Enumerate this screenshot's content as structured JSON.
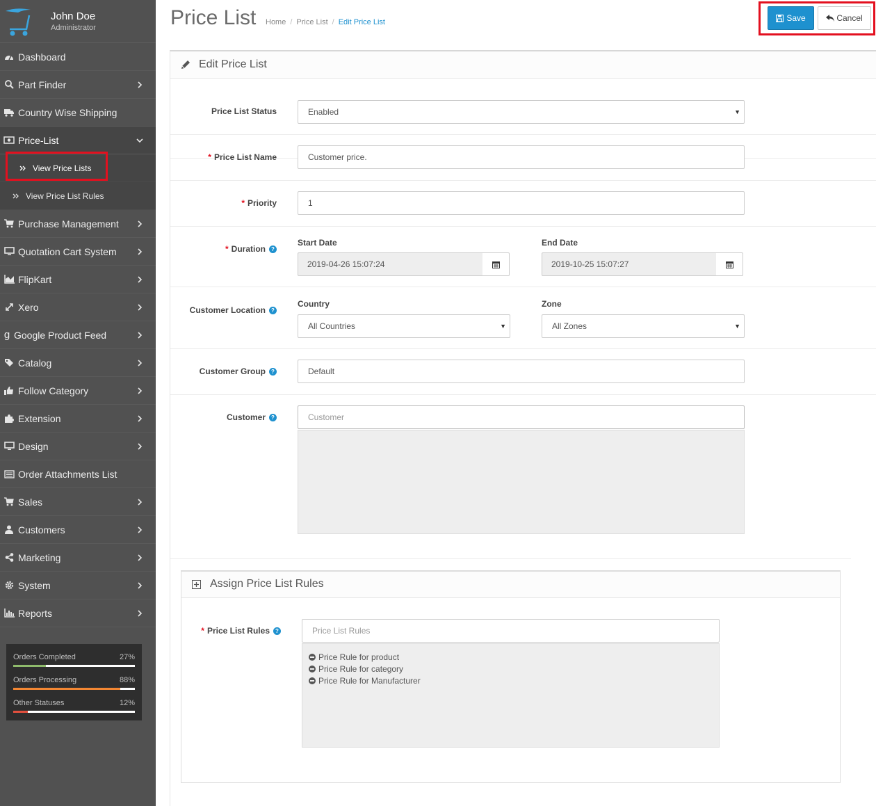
{
  "user": {
    "name": "John Doe",
    "role": "Administrator"
  },
  "sidebar": {
    "items": [
      {
        "label": "Dashboard",
        "icon": "dashboard-icon"
      },
      {
        "label": "Part Finder",
        "icon": "search-icon"
      },
      {
        "label": "Country Wise Shipping",
        "icon": "truck-icon"
      },
      {
        "label": "Price-List",
        "icon": "money-icon"
      },
      {
        "label": "Purchase Management",
        "icon": "cart-icon"
      },
      {
        "label": "Quotation Cart System",
        "icon": "desktop-icon"
      },
      {
        "label": "FlipKart",
        "icon": "area-chart-icon"
      },
      {
        "label": "Xero",
        "icon": "arrows-icon"
      },
      {
        "label": "Google Product Feed",
        "icon": "google-icon"
      },
      {
        "label": "Catalog",
        "icon": "tags-icon"
      },
      {
        "label": "Follow Category",
        "icon": "thumbs-up-icon"
      },
      {
        "label": "Extension",
        "icon": "puzzle-icon"
      },
      {
        "label": "Design",
        "icon": "desktop-icon"
      },
      {
        "label": "Order Attachments List",
        "icon": "list-icon"
      },
      {
        "label": "Sales",
        "icon": "cart-icon"
      },
      {
        "label": "Customers",
        "icon": "user-icon"
      },
      {
        "label": "Marketing",
        "icon": "share-icon"
      },
      {
        "label": "System",
        "icon": "cog-icon"
      },
      {
        "label": "Reports",
        "icon": "bar-chart-icon"
      }
    ],
    "sub_items": [
      {
        "label": "View Price Lists"
      },
      {
        "label": "View Price List Rules"
      }
    ]
  },
  "stats": [
    {
      "label": "Orders Completed",
      "pct": "27%",
      "value": 27,
      "color": "#8fbb6c"
    },
    {
      "label": "Orders Processing",
      "pct": "88%",
      "value": 88,
      "color": "#f38733"
    },
    {
      "label": "Other Statuses",
      "pct": "12%",
      "value": 12,
      "color": "#e3503e"
    }
  ],
  "header": {
    "title": "Price List",
    "breadcrumb": [
      "Home",
      "Price List",
      "Edit Price List"
    ],
    "save_label": "Save",
    "cancel_label": "Cancel"
  },
  "form": {
    "panel_title": "Edit Price List",
    "status": {
      "label": "Price List Status",
      "value": "Enabled"
    },
    "name": {
      "label": "Price List Name",
      "value": "Customer price."
    },
    "priority": {
      "label": "Priority",
      "value": "1"
    },
    "duration": {
      "label": "Duration",
      "start_label": "Start Date",
      "start_value": "2019-04-26 15:07:24",
      "end_label": "End Date",
      "end_value": "2019-10-25 15:07:27"
    },
    "location": {
      "label": "Customer Location",
      "country_label": "Country",
      "country_value": "All Countries",
      "zone_label": "Zone",
      "zone_value": "All Zones"
    },
    "group": {
      "label": "Customer Group",
      "value": "Default"
    },
    "customer": {
      "label": "Customer",
      "placeholder": "Customer"
    }
  },
  "rules": {
    "panel_title": "Assign Price List Rules",
    "label": "Price List Rules",
    "placeholder": "Price List Rules",
    "items": [
      "Price Rule for product",
      "Price Rule for category",
      "Price Rule for Manufacturer"
    ]
  }
}
